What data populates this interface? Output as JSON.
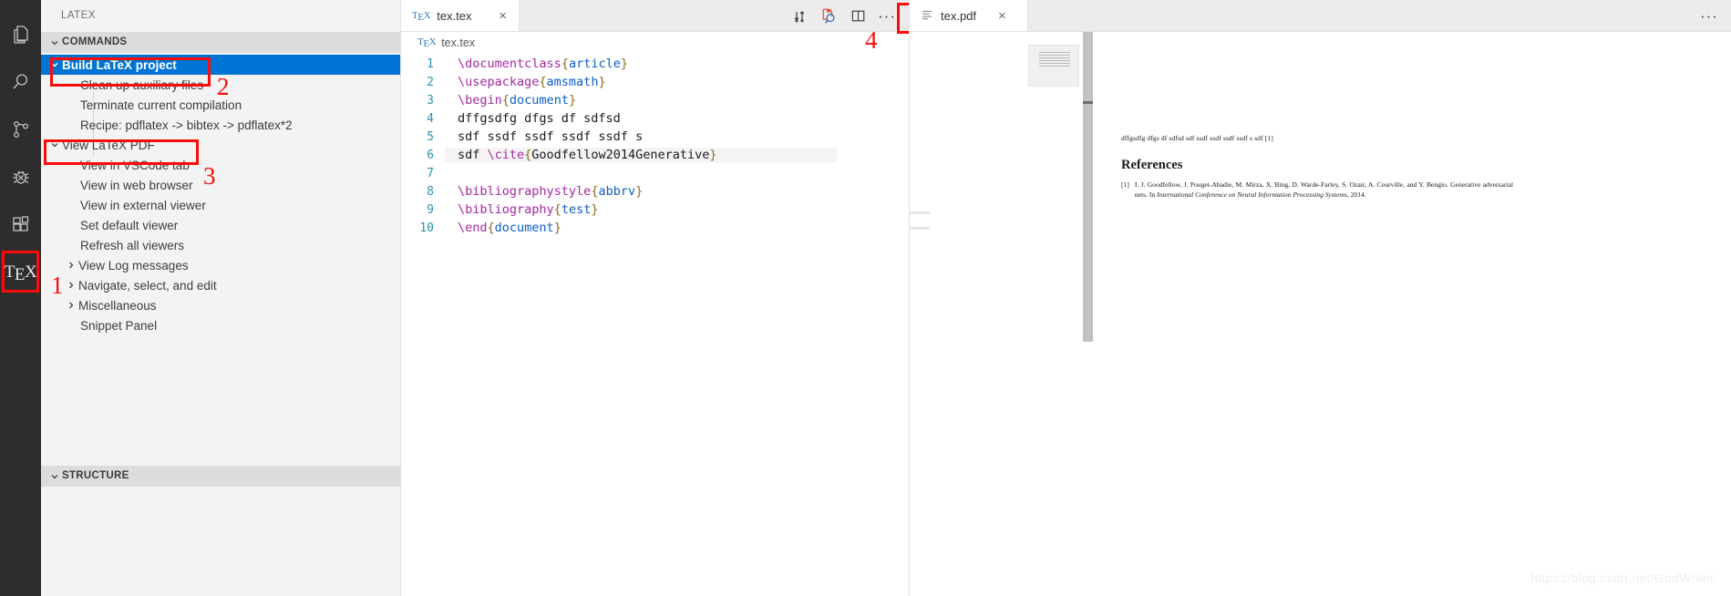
{
  "activity_bar": {
    "items": [
      {
        "name": "explorer",
        "icon": "files-icon"
      },
      {
        "name": "search",
        "icon": "search-icon"
      },
      {
        "name": "source-control",
        "icon": "source-control-icon"
      },
      {
        "name": "debug",
        "icon": "debug-icon"
      },
      {
        "name": "extensions",
        "icon": "extensions-icon"
      },
      {
        "name": "latex-workshop",
        "icon": "tex-icon",
        "label": "TeX",
        "active": true
      }
    ]
  },
  "sidebar": {
    "title": "LATEX",
    "sections": [
      {
        "label": "COMMANDS",
        "expanded": true
      },
      {
        "label": "STRUCTURE",
        "expanded": true
      }
    ],
    "commands": [
      {
        "label": "Build LaTeX project",
        "indent": 0,
        "twisty": "down",
        "selected": true
      },
      {
        "label": "Clean up auxiliary files",
        "indent": 1,
        "twisty": "none",
        "selected": false
      },
      {
        "label": "Terminate current compilation",
        "indent": 1,
        "twisty": "none",
        "selected": false
      },
      {
        "label": "Recipe: pdflatex -> bibtex -> pdflatex*2",
        "indent": 1,
        "twisty": "none",
        "selected": false
      },
      {
        "label": "View LaTeX PDF",
        "indent": 0,
        "twisty": "down",
        "selected": false
      },
      {
        "label": "View in VSCode tab",
        "indent": 1,
        "twisty": "none",
        "selected": false
      },
      {
        "label": "View in web browser",
        "indent": 1,
        "twisty": "none",
        "selected": false
      },
      {
        "label": "View in external viewer",
        "indent": 1,
        "twisty": "none",
        "selected": false
      },
      {
        "label": "Set default viewer",
        "indent": 1,
        "twisty": "none",
        "selected": false
      },
      {
        "label": "Refresh all viewers",
        "indent": 1,
        "twisty": "none",
        "selected": false
      },
      {
        "label": "View Log messages",
        "indent": 0,
        "twisty": "right",
        "selected": false
      },
      {
        "label": "Navigate, select, and edit",
        "indent": 0,
        "twisty": "right",
        "selected": false
      },
      {
        "label": "Miscellaneous",
        "indent": 0,
        "twisty": "right",
        "selected": false
      },
      {
        "label": "Snippet Panel",
        "indent": 0,
        "twisty": "none",
        "selected": false
      }
    ]
  },
  "annotations": {
    "color": "#fb0b09",
    "markers": [
      {
        "number": "1",
        "target": "tex-activity-bar-icon"
      },
      {
        "number": "2",
        "target": "build-latex-project"
      },
      {
        "number": "3",
        "target": "view-latex-pdf"
      },
      {
        "number": "4",
        "target": "view-pdf-toolbar-button"
      }
    ]
  },
  "editor": {
    "tab": {
      "title": "tex.tex",
      "icon": "tex-icon",
      "close": "×"
    },
    "breadcrumb": {
      "icon": "tex-icon",
      "label": "tex.tex"
    },
    "toolbar": [
      {
        "name": "build-latex-project-button",
        "icon": "sync-build-icon"
      },
      {
        "name": "view-latex-pdf-button",
        "icon": "pdf-search-icon",
        "highlighted": true
      },
      {
        "name": "split-editor-button",
        "icon": "split-editor-icon"
      },
      {
        "name": "more-actions-button",
        "icon": "ellipsis-icon",
        "label": "···"
      }
    ],
    "lines": [
      {
        "n": "1",
        "tokens": [
          {
            "t": "\\documentclass",
            "c": "cmd"
          },
          {
            "t": "{",
            "c": "brace"
          },
          {
            "t": "article",
            "c": "arg"
          },
          {
            "t": "}",
            "c": "brace"
          }
        ]
      },
      {
        "n": "2",
        "tokens": [
          {
            "t": "\\usepackage",
            "c": "cmd"
          },
          {
            "t": "{",
            "c": "brace"
          },
          {
            "t": "amsmath",
            "c": "arg"
          },
          {
            "t": "}",
            "c": "brace"
          }
        ]
      },
      {
        "n": "3",
        "tokens": [
          {
            "t": "\\begin",
            "c": "cmd"
          },
          {
            "t": "{",
            "c": "brace"
          },
          {
            "t": "document",
            "c": "arg"
          },
          {
            "t": "}",
            "c": "brace"
          }
        ]
      },
      {
        "n": "4",
        "tokens": [
          {
            "t": "dffgsdfg dfgs df sdfsd",
            "c": "text"
          }
        ]
      },
      {
        "n": "5",
        "tokens": [
          {
            "t": "sdf ssdf ssdf ssdf ssdf s",
            "c": "text"
          }
        ]
      },
      {
        "n": "6",
        "active": true,
        "tokens": [
          {
            "t": "sdf ",
            "c": "text"
          },
          {
            "t": "\\cite",
            "c": "cmd"
          },
          {
            "t": "{",
            "c": "brace"
          },
          {
            "t": "Goodfellow2014Generative",
            "c": "text"
          },
          {
            "t": "}",
            "c": "brace"
          }
        ]
      },
      {
        "n": "7",
        "tokens": []
      },
      {
        "n": "8",
        "tokens": [
          {
            "t": "\\bibliographystyle",
            "c": "cmd"
          },
          {
            "t": "{",
            "c": "brace"
          },
          {
            "t": "abbrv",
            "c": "arg"
          },
          {
            "t": "}",
            "c": "brace"
          }
        ]
      },
      {
        "n": "9",
        "tokens": [
          {
            "t": "\\bibliography",
            "c": "cmd"
          },
          {
            "t": "{",
            "c": "brace"
          },
          {
            "t": "test",
            "c": "arg"
          },
          {
            "t": "}",
            "c": "brace"
          }
        ]
      },
      {
        "n": "10",
        "tokens": [
          {
            "t": "\\end",
            "c": "cmd"
          },
          {
            "t": "{",
            "c": "brace"
          },
          {
            "t": "document",
            "c": "arg"
          },
          {
            "t": "}",
            "c": "brace"
          }
        ]
      }
    ]
  },
  "pdf_pane": {
    "tab": {
      "title": "tex.pdf",
      "icon": "pdf-lines-icon",
      "close": "×"
    },
    "more_label": "···",
    "document": {
      "paragraph": "dffgsdfg dfgs df sdfsd sdf ssdf ssdf ssdf ssdf s sdf [1]",
      "heading": "References",
      "bibliography": [
        {
          "number": "[1]",
          "authors": "I. J. Goodfellow, J. Pouget-Abadie, M. Mirza, X. Bing, D. Warde-Farley, S. Ozair, A. Courville, and Y. Bengio.",
          "title": "Generative adversarial nets.",
          "venue_prefix": "In",
          "venue": "International Conference on Neural Information Processing Systems",
          "year": ", 2014."
        }
      ]
    }
  },
  "watermark": "https://blog.csdn.net/GodWriter",
  "colors": {
    "accent_selection": "#0074d4",
    "annotation_red": "#fb0b09",
    "sidebar_bg": "#f3f3f3",
    "activitybar_bg": "#2d2d2d",
    "section_header_bg": "#dcdcdc"
  }
}
